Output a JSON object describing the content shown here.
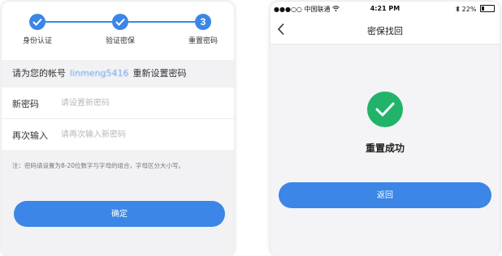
{
  "reset_form": {
    "steps": [
      {
        "label": "身份认证",
        "state": "done"
      },
      {
        "label": "验证密保",
        "state": "done"
      },
      {
        "label": "重置密码",
        "state": "active",
        "number": "3"
      }
    ],
    "notice_prefix": "请为您的帐号",
    "account": "linmeng5416",
    "notice_suffix": "重新设置密码",
    "fields": [
      {
        "label": "新密码",
        "value": "",
        "placeholder": "请设置新密码"
      },
      {
        "label": "再次输入",
        "value": "",
        "placeholder": "请再次输入新密码"
      }
    ],
    "hint": "注：密码请设置为8-20位数字与字母的组合，字母区分大小写。",
    "confirm_label": "确定"
  },
  "success_screen": {
    "status_bar": {
      "carrier": "●●●○○ 中国联通",
      "time": "4:21 PM",
      "battery": "22%"
    },
    "title": "密保找回",
    "success_text": "重置成功",
    "return_label": "返回"
  },
  "colors": {
    "accent": "#3b86e6",
    "success": "#22b36b",
    "background": "#f2f2f4"
  },
  "icons": [
    "check-icon",
    "back-arrow-icon",
    "wifi-icon",
    "bluetooth-icon",
    "battery-icon"
  ]
}
